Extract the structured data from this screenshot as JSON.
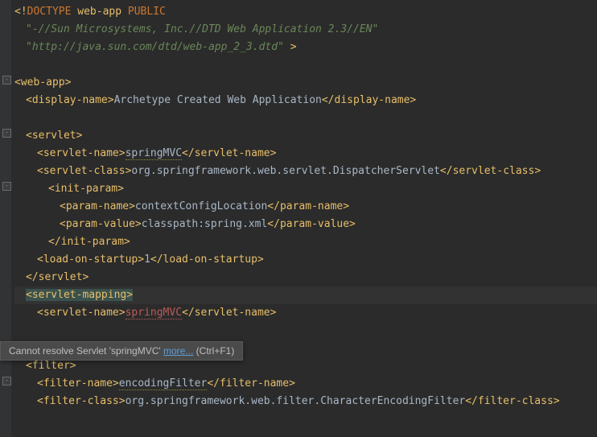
{
  "code": {
    "l1a": "<!",
    "l1b": "DOCTYPE",
    "l1c": " web-app ",
    "l1d": "PUBLIC",
    "l2": "\"-//Sun Microsystems, Inc.//DTD Web Application 2.3//EN\"",
    "l3": "\"http://java.sun.com/dtd/web-app_2_3.dtd\" ",
    "l3b": ">",
    "l5": "<web-app>",
    "l6a": "<display-name>",
    "l6b": "Archetype Created Web Application",
    "l6c": "</display-name>",
    "l8": "<servlet>",
    "l9a": "<servlet-name>",
    "l9b": "springMVC",
    "l9c": "</servlet-name>",
    "l10a": "<servlet-class>",
    "l10b": "org.springframework.web.servlet.DispatcherServlet",
    "l10c": "</servlet-class>",
    "l11": "<init-param>",
    "l12a": "<param-name>",
    "l12b": "contextConfigLocation",
    "l12c": "</param-name>",
    "l13a": "<param-value>",
    "l13b": "classpath:spring.xml",
    "l13c": "</param-value>",
    "l14": "</init-param>",
    "l15a": "<load-on-startup>",
    "l15b": "1",
    "l15c": "</load-on-startup>",
    "l16": "</servlet>",
    "l17": "<servlet-mapping>",
    "l18a": "<servlet-name>",
    "l18b": "springMVC",
    "l18c": "</servlet-name>",
    "l21": "<filter>",
    "l22a": "<filter-name>",
    "l22b": "encodingFilter",
    "l22c": "</filter-name>",
    "l23a": "<filter-class>",
    "l23b": "org.springframework.web.filter.CharacterEncodingFilter",
    "l23c": "</filter-class>"
  },
  "tooltip": {
    "msg": "Cannot resolve Servlet 'springMVC' ",
    "link": "more...",
    "suffix": " (Ctrl+F1)"
  }
}
